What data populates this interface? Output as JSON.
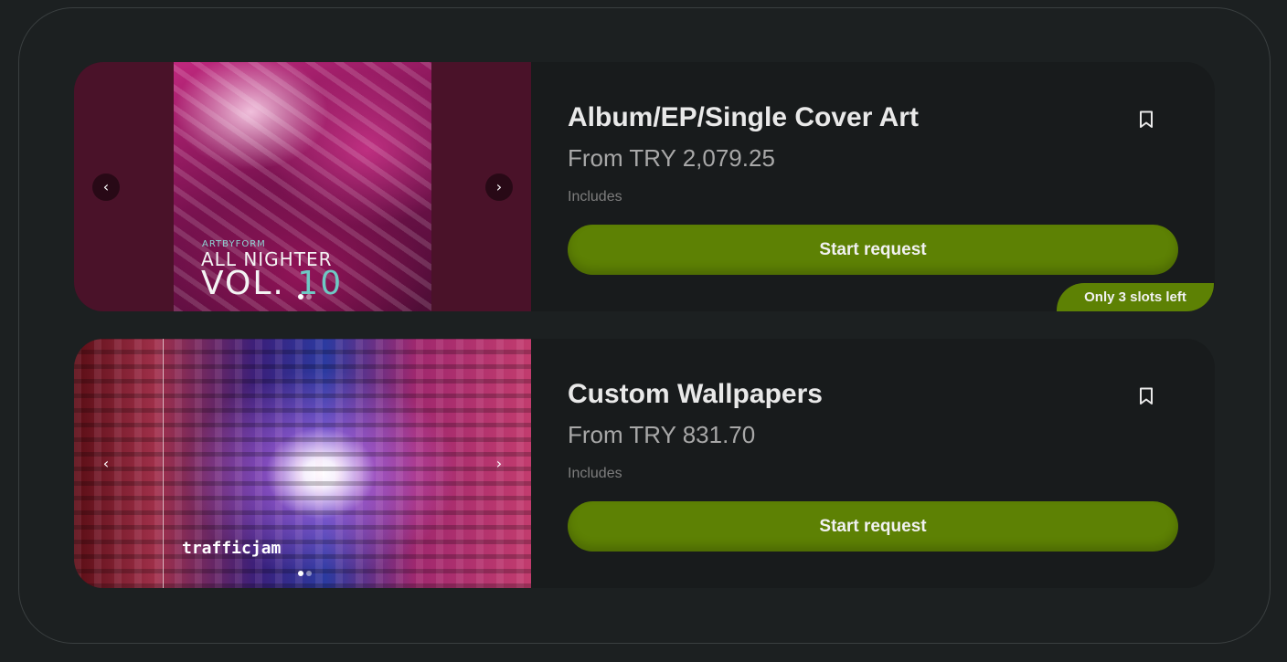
{
  "colors": {
    "background": "#1c2021",
    "card": "#1a1d1e",
    "accent": "#5d8104",
    "title": "#e9e9e9",
    "price": "#a8a8a8"
  },
  "services": [
    {
      "title": "Album/EP/Single Cover Art",
      "price": "From TRY 2,079.25",
      "includes_label": "Includes",
      "cta_label": "Start request",
      "bookmark_icon": "bookmark-icon",
      "slots_badge": "Only 3 slots left",
      "carousel": {
        "prev_glyph": "‹",
        "next_glyph": "›",
        "image_text": {
          "brand": "ARTBYFORM",
          "line1": "ALL NIGHTER",
          "line2_prefix": "VOL.",
          "line2_number": "10"
        }
      }
    },
    {
      "title": "Custom Wallpapers",
      "price": "From TRY 831.70",
      "includes_label": "Includes",
      "cta_label": "Start request",
      "bookmark_icon": "bookmark-icon",
      "carousel": {
        "prev_glyph": "‹",
        "next_glyph": "›",
        "image_text": {
          "brand": "trafficjam"
        }
      }
    }
  ]
}
